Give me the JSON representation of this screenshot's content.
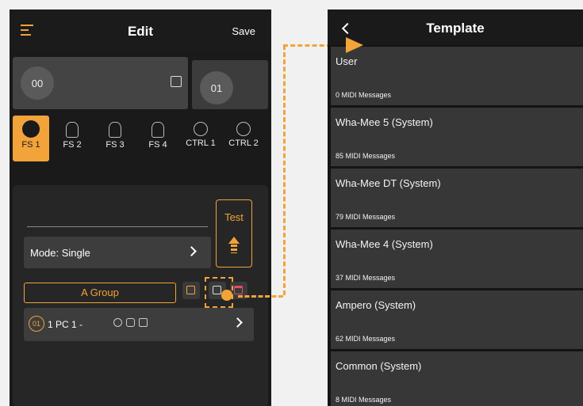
{
  "edit_screen": {
    "title": "Edit",
    "save_label": "Save",
    "preset_a": "00",
    "preset_b": "01",
    "footswitches": [
      "FS 1",
      "FS 2",
      "FS 3",
      "FS 4",
      "CTRL 1",
      "CTRL 2"
    ],
    "active_footswitch": "FS 1",
    "test_label": "Test",
    "mode_label": "Mode: Single",
    "group_label": "A Group",
    "message": {
      "badge": "01",
      "text": "1  PC  1  -"
    }
  },
  "template_screen": {
    "title": "Template",
    "items": [
      {
        "name": "User",
        "count": "0 MIDI Messages"
      },
      {
        "name": "Wha-Mee 5 (System)",
        "count": "85 MIDI Messages"
      },
      {
        "name": "Wha-Mee DT (System)",
        "count": "79 MIDI Messages"
      },
      {
        "name": "Wha-Mee 4 (System)",
        "count": "37 MIDI Messages"
      },
      {
        "name": "Ampero (System)",
        "count": "62 MIDI Messages"
      },
      {
        "name": "Common (System)",
        "count": "8 MIDI Messages"
      }
    ]
  },
  "colors": {
    "accent": "#f2a33a",
    "delete": "#e0506a"
  }
}
